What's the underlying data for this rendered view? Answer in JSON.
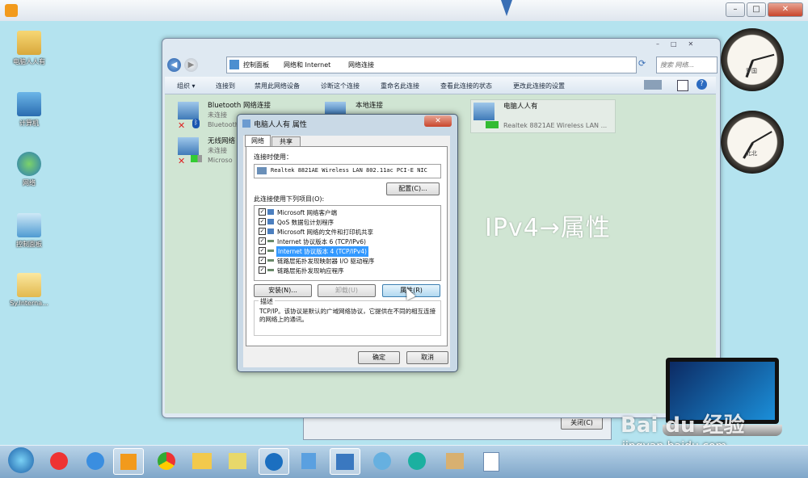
{
  "outer": {
    "title": ""
  },
  "desktop_icons": [
    {
      "label": "电脑人人有"
    },
    {
      "label": "计算机"
    },
    {
      "label": "网络"
    },
    {
      "label": "控制面板"
    },
    {
      "label": "Sy.Interna..."
    }
  ],
  "explorer": {
    "breadcrumb": [
      "控制面板",
      "网络和 Internet",
      "网络连接"
    ],
    "search_placeholder": "搜索 网络...",
    "commands": [
      "组织 ▾",
      "连接到",
      "禁用此网络设备",
      "诊断这个连接",
      "重命名此连接",
      "查看此连接的状态",
      "更改此连接的设置"
    ],
    "adapters": [
      {
        "name": "Bluetooth 网络连接",
        "status": "未连接",
        "device": "Bluetooth"
      },
      {
        "name": "本地连接",
        "status": "",
        "device": ""
      },
      {
        "name": "电脑人人有",
        "status": "",
        "device": "Realtek 8821AE Wireless LAN ..."
      },
      {
        "name": "无线网络",
        "status": "未连接",
        "device": "Microso"
      }
    ]
  },
  "dialog": {
    "title": "电脑人人有 属性",
    "tabs": [
      "网络",
      "共享"
    ],
    "connect_using_label": "连接时使用：",
    "adapter_name": "Realtek 8821AE Wireless LAN 802.11ac PCI-E NIC",
    "configure_button": "配置(C)...",
    "items_label": "此连接使用下列项目(O):",
    "items": [
      {
        "text": "Microsoft 网络客户端",
        "checked": true
      },
      {
        "text": "QoS 数据包计划程序",
        "checked": true
      },
      {
        "text": "Microsoft 网络的文件和打印机共享",
        "checked": true
      },
      {
        "text": "Internet 协议版本 6 (TCP/IPv6)",
        "checked": true
      },
      {
        "text": "Internet 协议版本 4 (TCP/IPv4)",
        "checked": true,
        "selected": true
      },
      {
        "text": "链路层拓扑发现映射器 I/O 驱动程序",
        "checked": true
      },
      {
        "text": "链路层拓扑发现响应程序",
        "checked": true
      }
    ],
    "install_button": "安装(N)...",
    "uninstall_button": "卸载(U)",
    "properties_button": "属性(R)",
    "description_label": "描述",
    "description_text": "TCP/IP。该协议是默认的广域网络协议，它提供在不同的相互连接的网络上的通讯。",
    "ok_button": "确定",
    "cancel_button": "取消"
  },
  "annotation": "IPv4→属性",
  "clocks": [
    {
      "city": "罗国"
    },
    {
      "city": "北北"
    }
  ],
  "close_button": "关闭(C)",
  "watermark": {
    "brand": "Bai du 经验",
    "url": "jingyan.baidu.com"
  }
}
